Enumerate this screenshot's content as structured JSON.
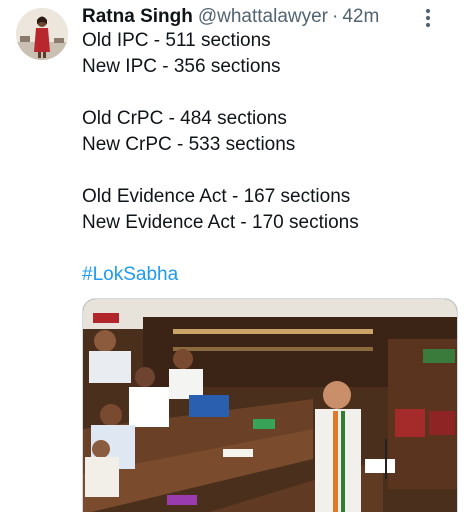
{
  "tweet": {
    "author": {
      "display_name": "Ratna Singh",
      "handle": "@whattalawyer",
      "separator": "·",
      "time": "42m"
    },
    "lines": [
      "Old IPC - 511 sections",
      "New IPC - 356 sections",
      "",
      "Old CrPC - 484 sections",
      "New CrPC - 533 sections",
      "",
      "Old Evidence Act - 167 sections",
      "New Evidence Act - 170 sections",
      ""
    ],
    "hashtag": "#LokSabha",
    "icons": {
      "more": "more-vertical-icon",
      "avatar": "avatar"
    },
    "colors": {
      "link": "#1d9bf0",
      "secondary_text": "#536471"
    }
  }
}
